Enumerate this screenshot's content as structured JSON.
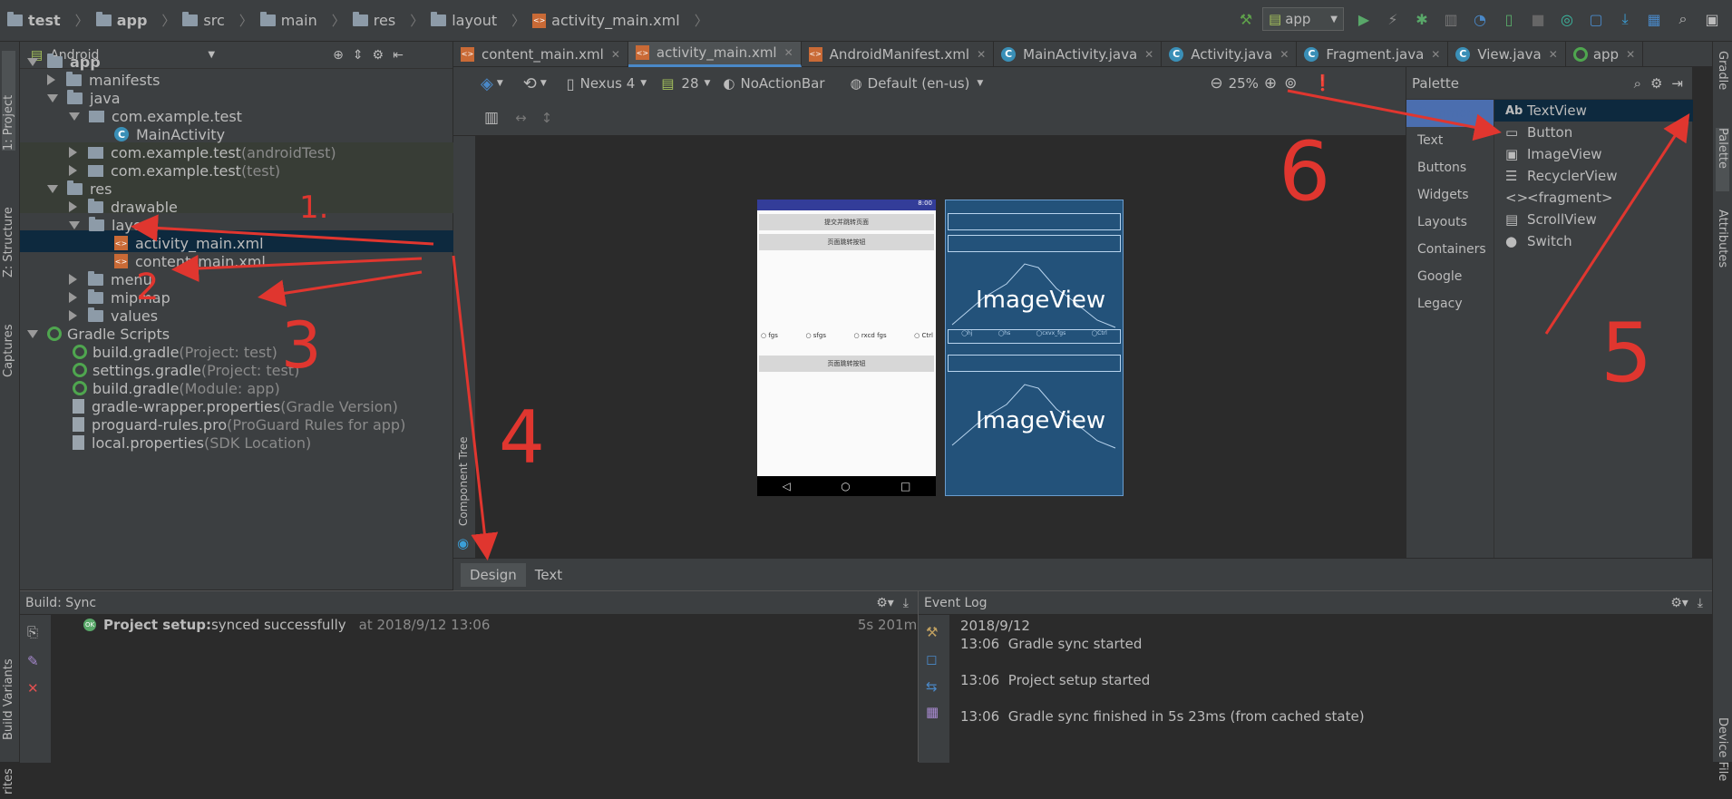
{
  "breadcrumbs": [
    "test",
    "app",
    "src",
    "main",
    "res",
    "layout",
    "activity_main.xml"
  ],
  "run_config": "app",
  "left_strip": {
    "project": "1: Project",
    "structure": "Z: Structure",
    "captures": "Captures",
    "build_variants": "Build Variants",
    "favorites": "rites"
  },
  "right_strip": {
    "gradle": "Gradle",
    "palette": "Palette",
    "attributes": "Attributes",
    "device_file": "Device File"
  },
  "project": {
    "view_mode": "Android",
    "tree": [
      {
        "label": "app",
        "grey": ""
      },
      {
        "label": "manifests",
        "grey": ""
      },
      {
        "label": "java",
        "grey": ""
      },
      {
        "label": "com.example.test",
        "grey": ""
      },
      {
        "label": "MainActivity",
        "grey": ""
      },
      {
        "label": "com.example.test",
        "grey": " (androidTest)"
      },
      {
        "label": "com.example.test",
        "grey": " (test)"
      },
      {
        "label": "res",
        "grey": ""
      },
      {
        "label": "drawable",
        "grey": ""
      },
      {
        "label": "layout",
        "grey": ""
      },
      {
        "label": "activity_main.xml",
        "grey": ""
      },
      {
        "label": "content_main.xml",
        "grey": ""
      },
      {
        "label": "menu",
        "grey": ""
      },
      {
        "label": "mipmap",
        "grey": ""
      },
      {
        "label": "values",
        "grey": ""
      },
      {
        "label": "Gradle Scripts",
        "grey": ""
      },
      {
        "label": "build.gradle",
        "grey": " (Project: test)"
      },
      {
        "label": "settings.gradle",
        "grey": " (Project: test)"
      },
      {
        "label": "build.gradle",
        "grey": " (Module: app)"
      },
      {
        "label": "gradle-wrapper.properties",
        "grey": " (Gradle Version)"
      },
      {
        "label": "proguard-rules.pro",
        "grey": " (ProGuard Rules for app)"
      },
      {
        "label": "local.properties",
        "grey": " (SDK Location)"
      }
    ]
  },
  "tabs": [
    "content_main.xml",
    "activity_main.xml",
    "AndroidManifest.xml",
    "MainActivity.java",
    "Activity.java",
    "Fragment.java",
    "View.java",
    "app"
  ],
  "design_toolbar": {
    "device": "Nexus 4",
    "api": "28",
    "theme": "NoActionBar",
    "locale": "Default (en-us)",
    "zoom": "25%"
  },
  "component_tree": "Component Tree",
  "phone": {
    "status_time": "8:00",
    "button1": "提交并跳转页面",
    "button2": "页面跳转按钮",
    "radios": [
      "fgs",
      "sfgs",
      "rxcd fgs",
      "Ctrl"
    ],
    "button3": "页面跳转按钮",
    "image_label": "ImageView",
    "radios_bp": [
      "hj",
      "hs",
      "cxvx_fgs",
      "Ctrl"
    ]
  },
  "palette": {
    "title": "Palette",
    "categories": [
      "Common",
      "Text",
      "Buttons",
      "Widgets",
      "Layouts",
      "Containers",
      "Google",
      "Legacy"
    ],
    "items": [
      {
        "icon": "Ab",
        "label": "TextView"
      },
      {
        "icon": "▭",
        "label": "Button"
      },
      {
        "icon": "▣",
        "label": "ImageView"
      },
      {
        "icon": "☰",
        "label": "RecyclerView"
      },
      {
        "icon": "<>",
        "label": "<fragment>"
      },
      {
        "icon": "▤",
        "label": "ScrollView"
      },
      {
        "icon": "●",
        "label": "Switch"
      }
    ]
  },
  "design_tabs": [
    "Design",
    "Text"
  ],
  "build": {
    "title": "Build: Sync",
    "status_bold": "Project setup:",
    "status": " synced successfully",
    "time": "at 2018/9/12 13:06",
    "duration": "5s 201ms"
  },
  "event_log": {
    "title": "Event Log",
    "date": "2018/9/12",
    "entries": [
      {
        "time": "13:06",
        "msg": "Gradle sync started"
      },
      {
        "time": "13:06",
        "msg": "Project setup started"
      },
      {
        "time": "13:06",
        "msg": "Gradle sync finished in 5s 23ms (from cached state)"
      }
    ]
  },
  "annotations": [
    "1.",
    "2",
    "3",
    "4",
    "6",
    "5"
  ],
  "colors": {
    "accent": "#4a88c7",
    "annotation": "#e0362f",
    "blueprint": "#23527a"
  }
}
